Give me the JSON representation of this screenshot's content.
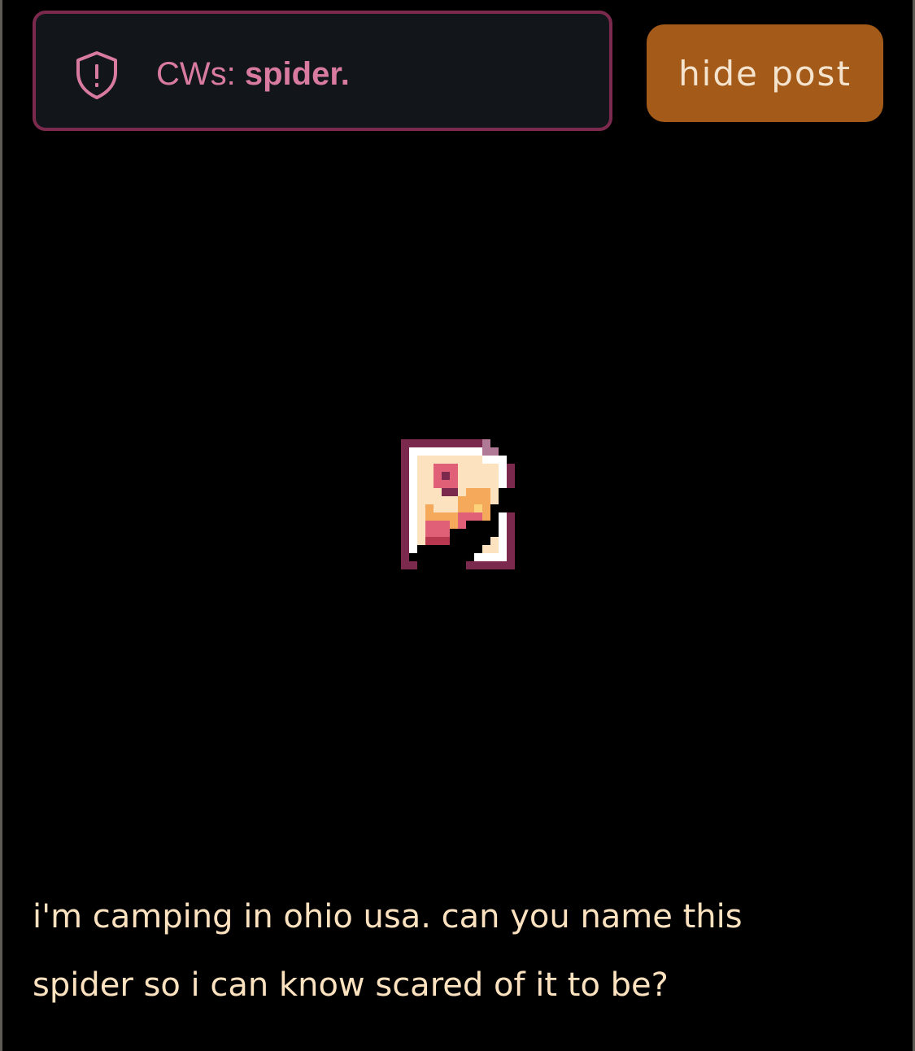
{
  "content_warning": {
    "label": "CWs: ",
    "value": "spider.",
    "icon": "shield-alert-icon"
  },
  "hide_button": {
    "label": "hide post"
  },
  "image": {
    "icon": "broken-image-icon"
  },
  "post": {
    "line1": "i'm camping in ohio usa. can you name this",
    "line2": "spider so i can know scared of it to be?"
  },
  "colors": {
    "background": "#000000",
    "cw_border": "#7b2a4d",
    "cw_text": "#d97ba1",
    "button_bg": "#a45a18",
    "button_text": "#f4e3cd",
    "body_text": "#fde2c0"
  }
}
